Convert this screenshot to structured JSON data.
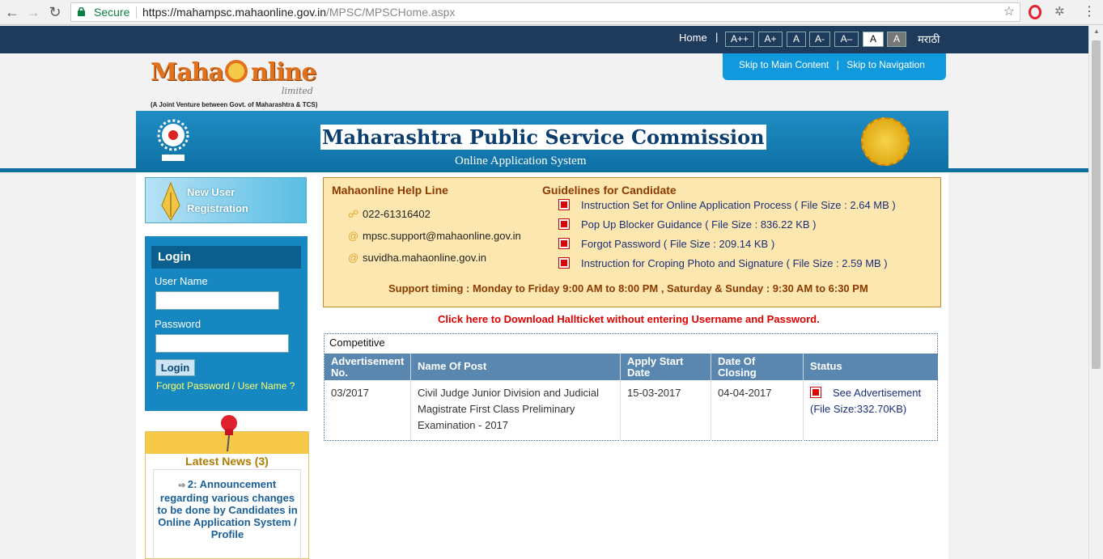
{
  "browser": {
    "secure_label": "Secure",
    "url_base": "https://mahampsc.mahaonline.gov.in",
    "url_path": "/MPSC/MPSCHome.aspx"
  },
  "topbar": {
    "home": "Home",
    "pipe": "|",
    "font_buttons": [
      "A++",
      "A+",
      "A",
      "A-",
      "A–",
      "A",
      "A"
    ],
    "marathi": "मराठी"
  },
  "logo": {
    "name_left": "Maha",
    "name_right": "nline",
    "sub": "limited",
    "tagline": "(A Joint Venture between Govt. of Maharashtra & TCS)"
  },
  "skip": {
    "main": "Skip to Main Content",
    "sep": "|",
    "nav": "Skip to Navigation"
  },
  "banner": {
    "title": "Maharashtra Public Service Commission",
    "subtitle": "Online Application System"
  },
  "sidebar": {
    "new_user_label": "New User Registration",
    "login": {
      "heading": "Login",
      "username_label": "User Name",
      "username_value": "",
      "password_label": "Password",
      "password_value": "",
      "button": "Login",
      "forgot": "Forgot Password / User Name ?"
    },
    "news": {
      "title": "Latest News (3)",
      "item": "2: Announcement regarding various changes to be done by Candidates in Online Application System / Profile"
    }
  },
  "helpline": {
    "heading": "Mahaonline Help Line",
    "phone": "022-61316402",
    "email": "mpsc.support@mahaonline.gov.in",
    "site": "suvidha.mahaonline.gov.in"
  },
  "guidelines": {
    "heading": "Guidelines for Candidate",
    "items": [
      "Instruction Set for Online Application Process ( File Size : 2.64 MB )",
      "Pop Up Blocker Guidance ( File Size : 836.22 KB )",
      "Forgot Password ( File Size : 209.14 KB )",
      "Instruction for Croping Photo and Signature ( File Size : 2.59 MB )"
    ]
  },
  "support_timing": "Support timing : Monday to Friday 9:00 AM to 8:00 PM , Saturday & Sunday : 9:30 AM to 6:30 PM",
  "hallticket_link": "Click here to Download Hallticket without entering Username and Password.",
  "competitive": {
    "label": "Competitive",
    "columns": [
      "Advertisement No.",
      "Name Of Post",
      "Apply Start Date",
      "Date Of Closing",
      "Status"
    ],
    "rows": [
      {
        "adv_no": "03/2017",
        "post": "Civil Judge Junior Division and Judicial Magistrate First Class Preliminary Examination - 2017",
        "start": "15-03-2017",
        "closing": "04-04-2017",
        "status_link": "See Advertisement",
        "status_size": "(File Size:332.70KB)"
      }
    ]
  },
  "colors": {
    "topbar": "#1f3b5c",
    "banner": "#1f8dc4",
    "login_panel": "#1787c2",
    "helpbox": "#fde7b0",
    "table_header": "#5a87b0",
    "hallticket": "#e00000"
  }
}
